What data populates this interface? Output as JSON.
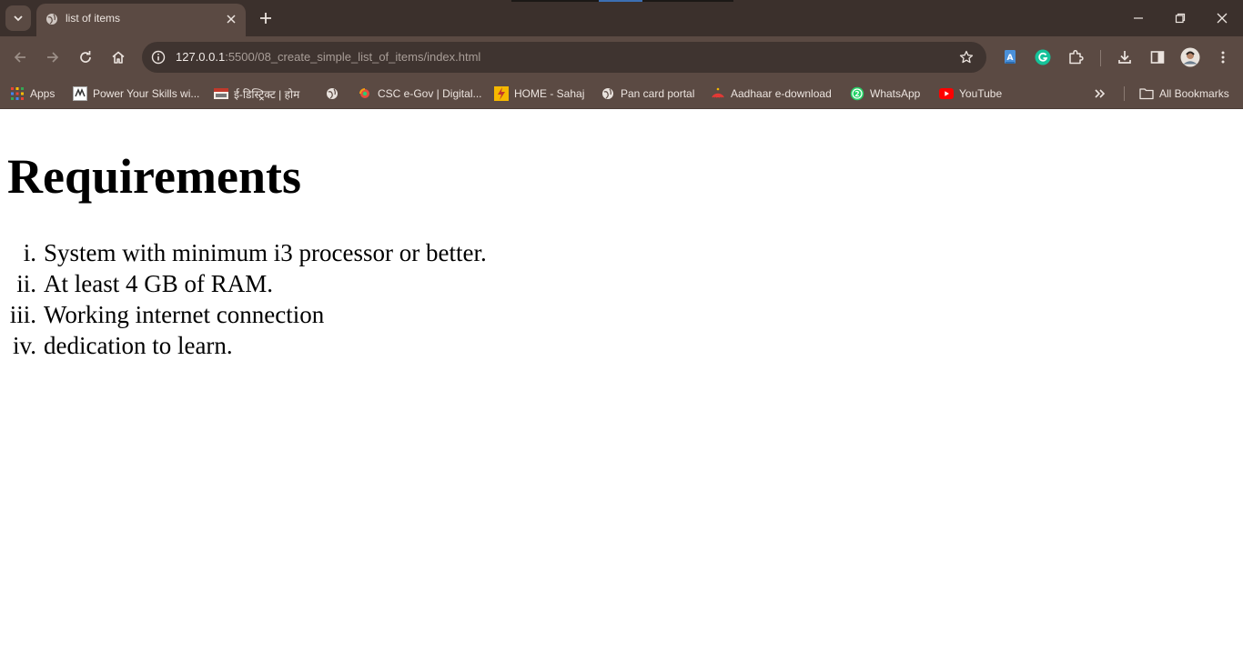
{
  "browser": {
    "tab": {
      "title": "list of items"
    },
    "address": {
      "host": "127.0.0.1",
      "rest": ":5500/08_create_simple_list_of_items/index.html"
    },
    "bookmarks": [
      {
        "label": "Apps",
        "icon": "apps-grid-icon"
      },
      {
        "label": "Power Your Skills wi...",
        "icon": "site-favicon-icon"
      },
      {
        "label": "ई-डिस्ट्रिक्ट | होम",
        "icon": "edistrict-favicon-icon"
      },
      {
        "label": "",
        "icon": "globe-icon"
      },
      {
        "label": "CSC e-Gov | Digital...",
        "icon": "csc-favicon-icon"
      },
      {
        "label": "HOME - Sahaj",
        "icon": "sahaj-favicon-icon"
      },
      {
        "label": "Pan card portal",
        "icon": "globe-icon"
      },
      {
        "label": "Aadhaar e-download",
        "icon": "aadhaar-favicon-icon"
      },
      {
        "label": "WhatsApp",
        "icon": "whatsapp-icon"
      },
      {
        "label": "YouTube",
        "icon": "youtube-icon"
      }
    ],
    "all_bookmarks_label": "All Bookmarks",
    "colors": {
      "frame": "#3b302c",
      "toolbar": "#5b4a43",
      "omnibox": "#3f3430"
    }
  },
  "page": {
    "heading": "Requirements",
    "list": [
      {
        "marker": "i.",
        "text": "System with minimum i3 processor or better."
      },
      {
        "marker": "ii.",
        "text": "At least 4 GB of RAM."
      },
      {
        "marker": "iii.",
        "text": "Working internet connection"
      },
      {
        "marker": "iv.",
        "text": "dedication to learn."
      }
    ]
  }
}
